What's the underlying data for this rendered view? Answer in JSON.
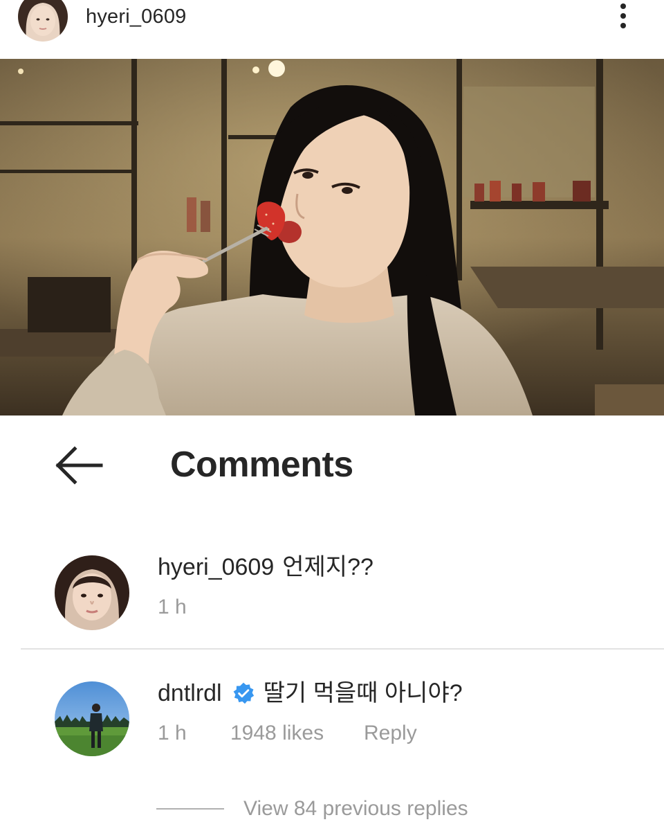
{
  "post": {
    "username": "hyeri_0609",
    "more_icon": "more-vertical-icon",
    "photo_description_icon": "post-photo"
  },
  "comments_header": {
    "back_icon": "arrow-left-icon",
    "title": "Comments"
  },
  "comments": [
    {
      "username": "hyeri_0609",
      "text": "언제지??",
      "time": "1 h",
      "verified": false
    },
    {
      "username": "dntlrdl",
      "text": "딸기 먹을때 아니야?",
      "time": "1 h",
      "likes": "1948 likes",
      "reply_label": "Reply",
      "verified": true
    }
  ],
  "view_replies": "View 84 previous replies",
  "colors": {
    "text": "#262626",
    "secondary": "#9a9a9a",
    "verified": "#3897f0",
    "divider": "#e2e2e2"
  }
}
